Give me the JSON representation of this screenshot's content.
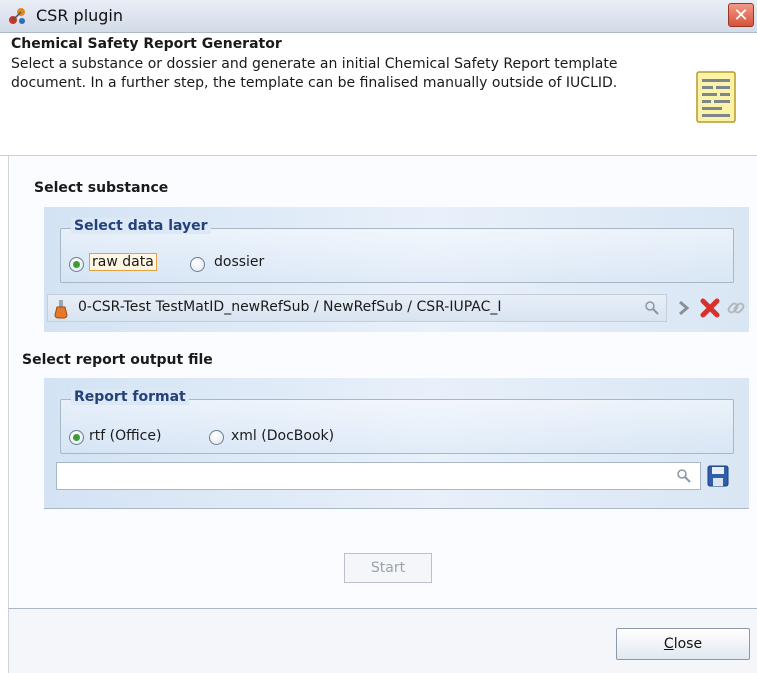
{
  "window": {
    "title": "CSR plugin"
  },
  "header": {
    "title": "Chemical Safety Report Generator",
    "description": "Select a substance or dossier and generate an initial Chemical Safety Report template document. In a further step, the template can be finalised manually outside of IUCLID."
  },
  "substance": {
    "section_title": "Select substance",
    "data_layer": {
      "legend": "Select data layer",
      "options": [
        {
          "label": "raw data",
          "selected": true
        },
        {
          "label": "dossier",
          "selected": false
        }
      ]
    },
    "reference_value": "0-CSR-Test TestMatID_newRefSub / NewRefSub / CSR-IUPAC_I"
  },
  "output": {
    "section_title": "Select report output file",
    "format": {
      "legend": "Report format",
      "options": [
        {
          "label": "rtf (Office)",
          "selected": true
        },
        {
          "label": "xml (DocBook)",
          "selected": false
        }
      ]
    },
    "file_path": ""
  },
  "buttons": {
    "start": "Start",
    "close": "Close"
  },
  "icons": {
    "app": "csr-plugin-icon",
    "header": "report-document-icon",
    "reference": "flask-icon",
    "search": "magnifier-icon",
    "navigate": "arrow-right-icon",
    "remove": "red-x-icon",
    "link": "chain-link-icon",
    "save": "floppy-disk-icon"
  },
  "colors": {
    "accent_legend": "#23427a",
    "radio_selected": "#3d9d34",
    "remove_red": "#d8302a"
  }
}
